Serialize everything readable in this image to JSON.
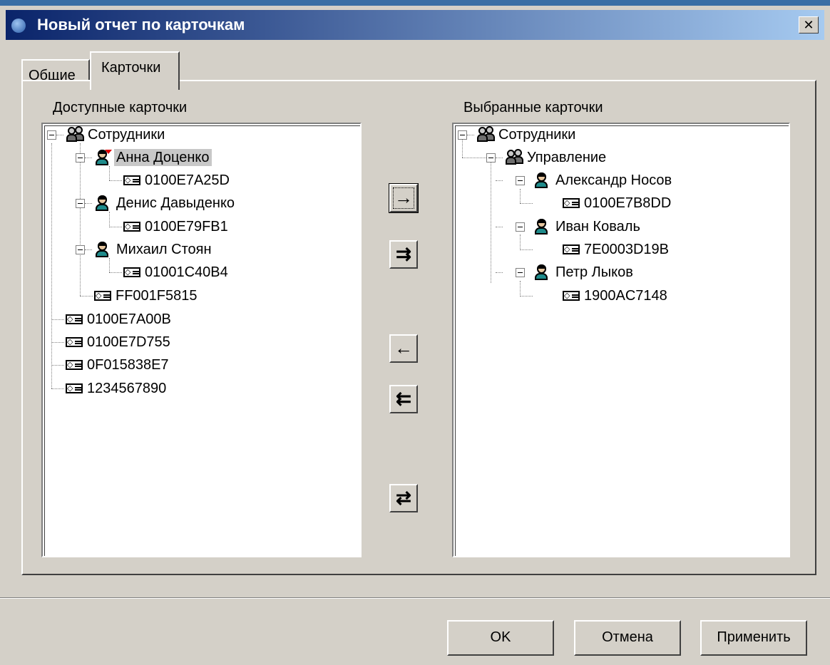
{
  "window": {
    "title": "Новый отчет по карточкам",
    "close_symbol": "✕"
  },
  "tabs": [
    {
      "label": "Общие"
    },
    {
      "label": "Карточки"
    }
  ],
  "available": {
    "label": "Доступные карточки",
    "nodes": {
      "employees": "Сотрудники",
      "anna": "Анна Доценко",
      "anna_card": "0100E7A25D",
      "denis": "Денис Давыденко",
      "denis_card": "0100E79FB1",
      "mikhail": "Михаил Стоян",
      "mikhail_card": "01001C40B4",
      "emp_card": "FF001F5815",
      "card1": "0100E7A00B",
      "card2": "0100E7D755",
      "card3": "0F015838E7",
      "card4": "1234567890"
    }
  },
  "selected": {
    "label": "Выбранные карточки",
    "nodes": {
      "employees": "Сотрудники",
      "management": "Управление",
      "alexander": "Александр Носов",
      "alexander_card": "0100E7B8DD",
      "ivan": "Иван Коваль",
      "ivan_card": "7E0003D19B",
      "petr": "Петр Лыков",
      "petr_card": "1900AC7148"
    }
  },
  "move_buttons": {
    "add_one": "→",
    "add_all": "⇉",
    "remove_one": "←",
    "remove_all": "⇇",
    "swap": "⇄"
  },
  "footer": {
    "ok": "OK",
    "cancel": "Отмена",
    "apply": "Применить"
  }
}
